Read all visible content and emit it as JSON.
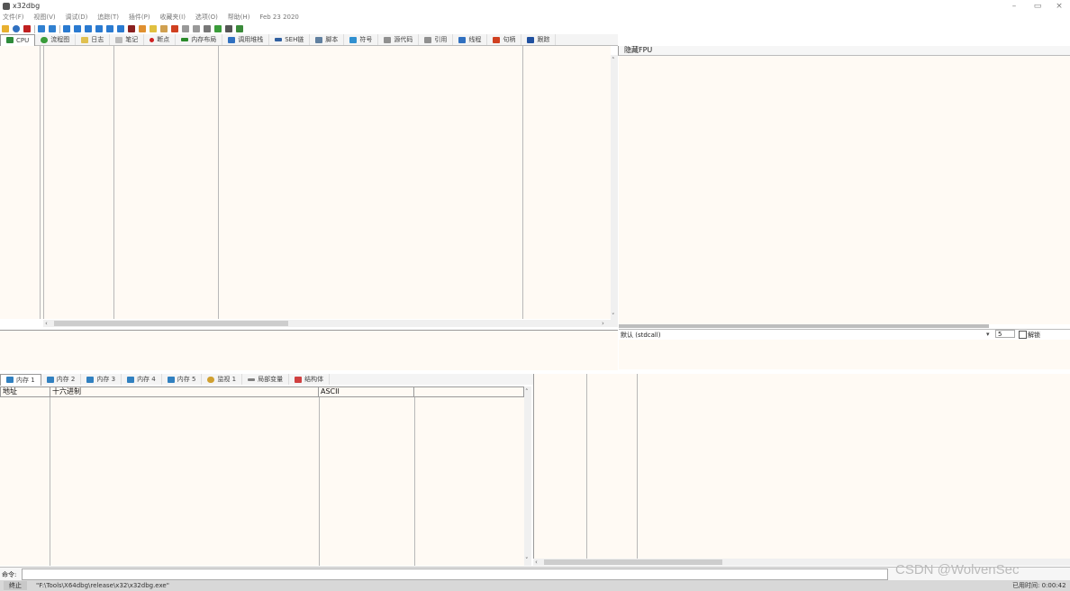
{
  "window": {
    "title": "x32dbg",
    "minimize": "–",
    "restore": "▭",
    "close": "×"
  },
  "menu": [
    "文件(F)",
    "视图(V)",
    "调试(D)",
    "追踪(T)",
    "插件(P)",
    "收藏夹(I)",
    "选项(O)",
    "帮助(H)",
    "Feb 23 2020"
  ],
  "tabs": [
    {
      "label": "CPU",
      "color": "#2e8b3a"
    },
    {
      "label": "流程图",
      "color": "#3a9c3a"
    },
    {
      "label": "日志",
      "color": "#e0c050"
    },
    {
      "label": "笔记",
      "color": "#999999"
    },
    {
      "label": "断点",
      "color": "#d02020"
    },
    {
      "label": "内存布局",
      "color": "#2a8a2a"
    },
    {
      "label": "调用堆栈",
      "color": "#3070c0"
    },
    {
      "label": "SEH链",
      "color": "#3060a0"
    },
    {
      "label": "脚本",
      "color": "#6080a0"
    },
    {
      "label": "符号",
      "color": "#3090d0"
    },
    {
      "label": "源代码",
      "color": "#909090"
    },
    {
      "label": "引用",
      "color": "#909090"
    },
    {
      "label": "线程",
      "color": "#3070c0"
    },
    {
      "label": "句柄",
      "color": "#d04020"
    },
    {
      "label": "跟踪",
      "color": "#2050a0"
    }
  ],
  "fpu": {
    "title": "隐藏FPU"
  },
  "callconv": {
    "label": "默认 (stdcall)",
    "count": "5",
    "checkbox_label": "解锁"
  },
  "memory_tabs": [
    {
      "label": "内存 1",
      "color": "#3080c0"
    },
    {
      "label": "内存 2",
      "color": "#3080c0"
    },
    {
      "label": "内存 3",
      "color": "#3080c0"
    },
    {
      "label": "内存 4",
      "color": "#3080c0"
    },
    {
      "label": "内存 5",
      "color": "#3080c0"
    },
    {
      "label": "监视 1",
      "color": "#d0a030"
    },
    {
      "label": "局部变量",
      "color": "#808080"
    },
    {
      "label": "结构体",
      "color": "#d04040"
    }
  ],
  "dump_headers": {
    "address": "地址",
    "hex": "十六进制",
    "ascii": "ASCII"
  },
  "command": {
    "label": "命令:"
  },
  "status": {
    "state": "终止",
    "message": "\"F:\\Tools\\X64dbg\\release\\x32\\x32dbg.exe\"",
    "right": "已用时间: 0:00:42"
  },
  "watermark": "CSDN @WolvenSec"
}
